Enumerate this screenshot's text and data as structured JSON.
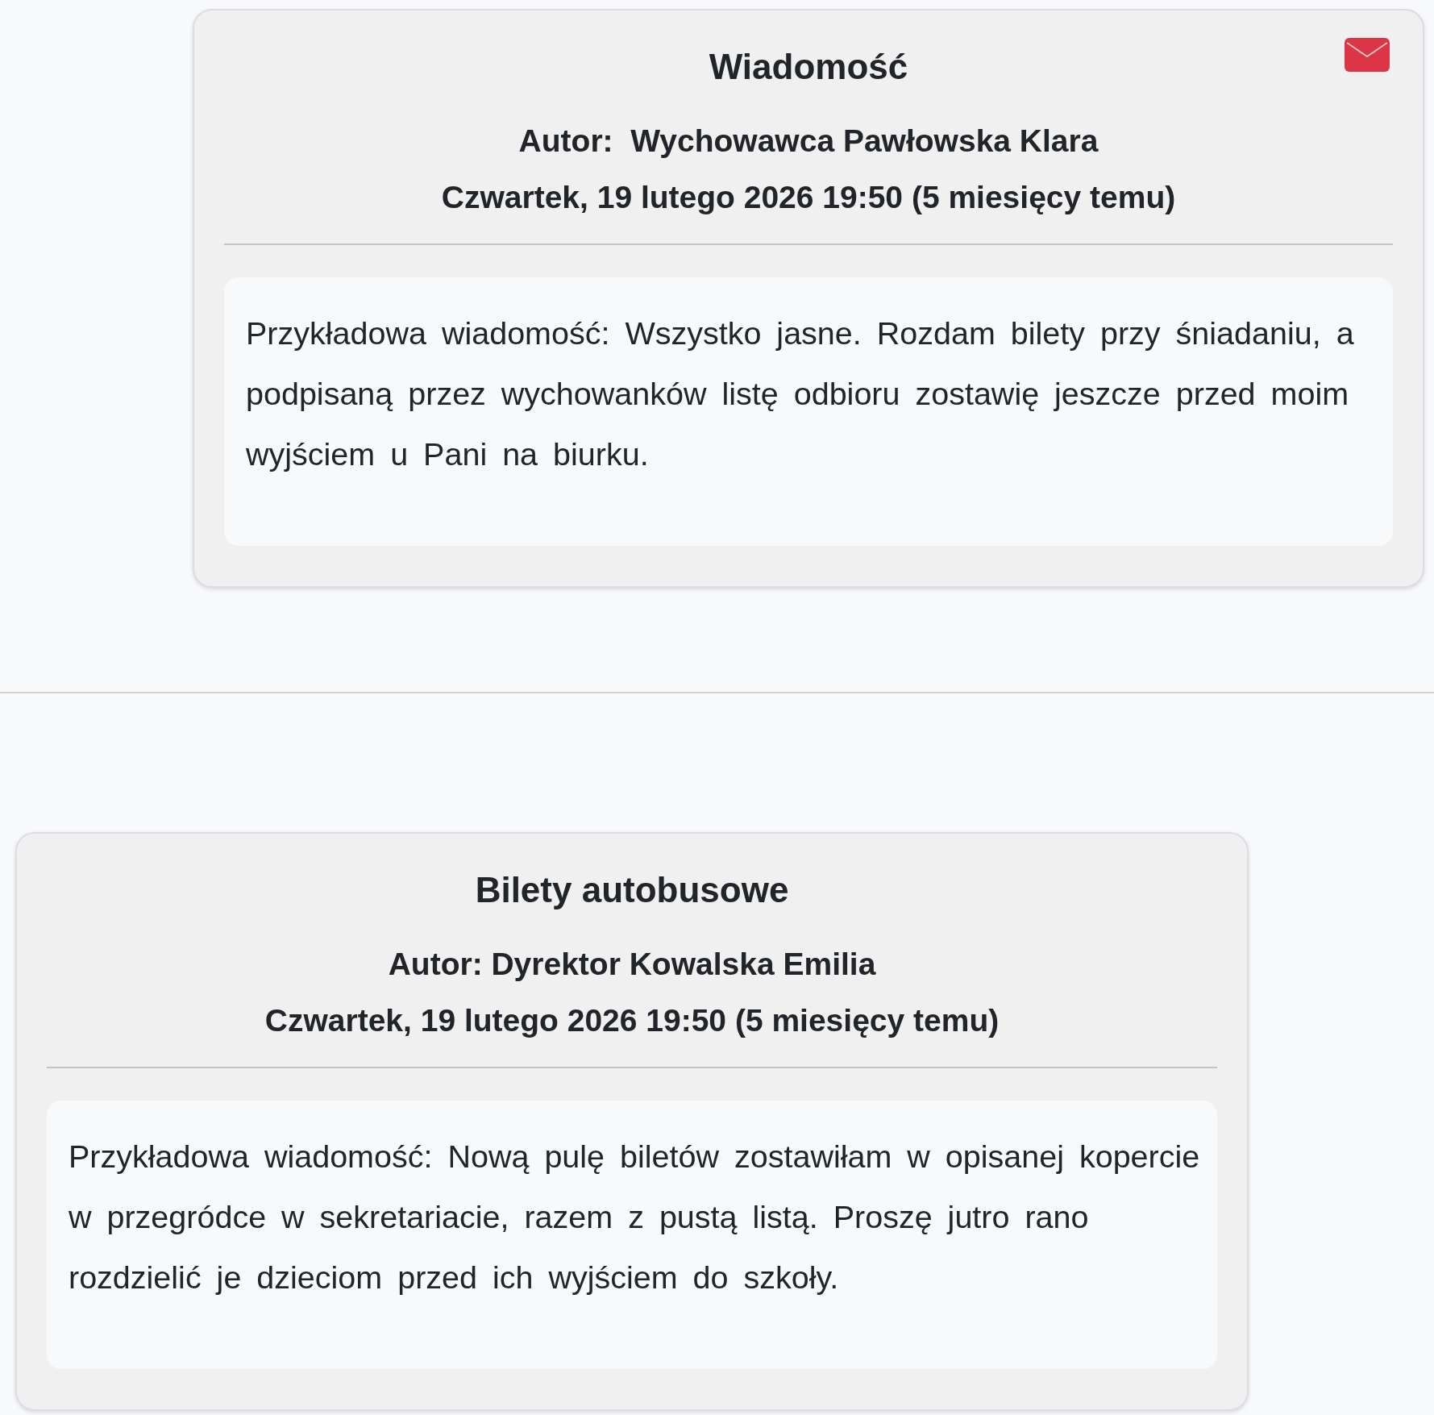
{
  "messages": [
    {
      "title": "Wiadomość",
      "unread": true,
      "author": "Autor:  Wychowawca Pawłowska Klara",
      "date": "Czwartek, 19 lutego 2026 19:50 (5 miesięcy temu)",
      "body": "Przykładowa wiadomość: Wszystko jasne. Rozdam bilety przy śniadaniu, a podpisaną przez wychowanków listę odbioru zostawię jeszcze przed moim wyjściem u Pani na biurku."
    },
    {
      "title": "Bilety autobusowe",
      "unread": false,
      "author": "Autor: Dyrektor Kowalska Emilia",
      "date": "Czwartek, 19 lutego 2026 19:50 (5 miesięcy temu)",
      "body": "Przykładowa wiadomość: Nową pulę biletów zostawiłam w opisanej kopercie w przegródce w sekretariacie, razem z pustą listą. Proszę jutro rano rozdzielić je dzieciom przed ich wyjściem do szkoły."
    }
  ]
}
